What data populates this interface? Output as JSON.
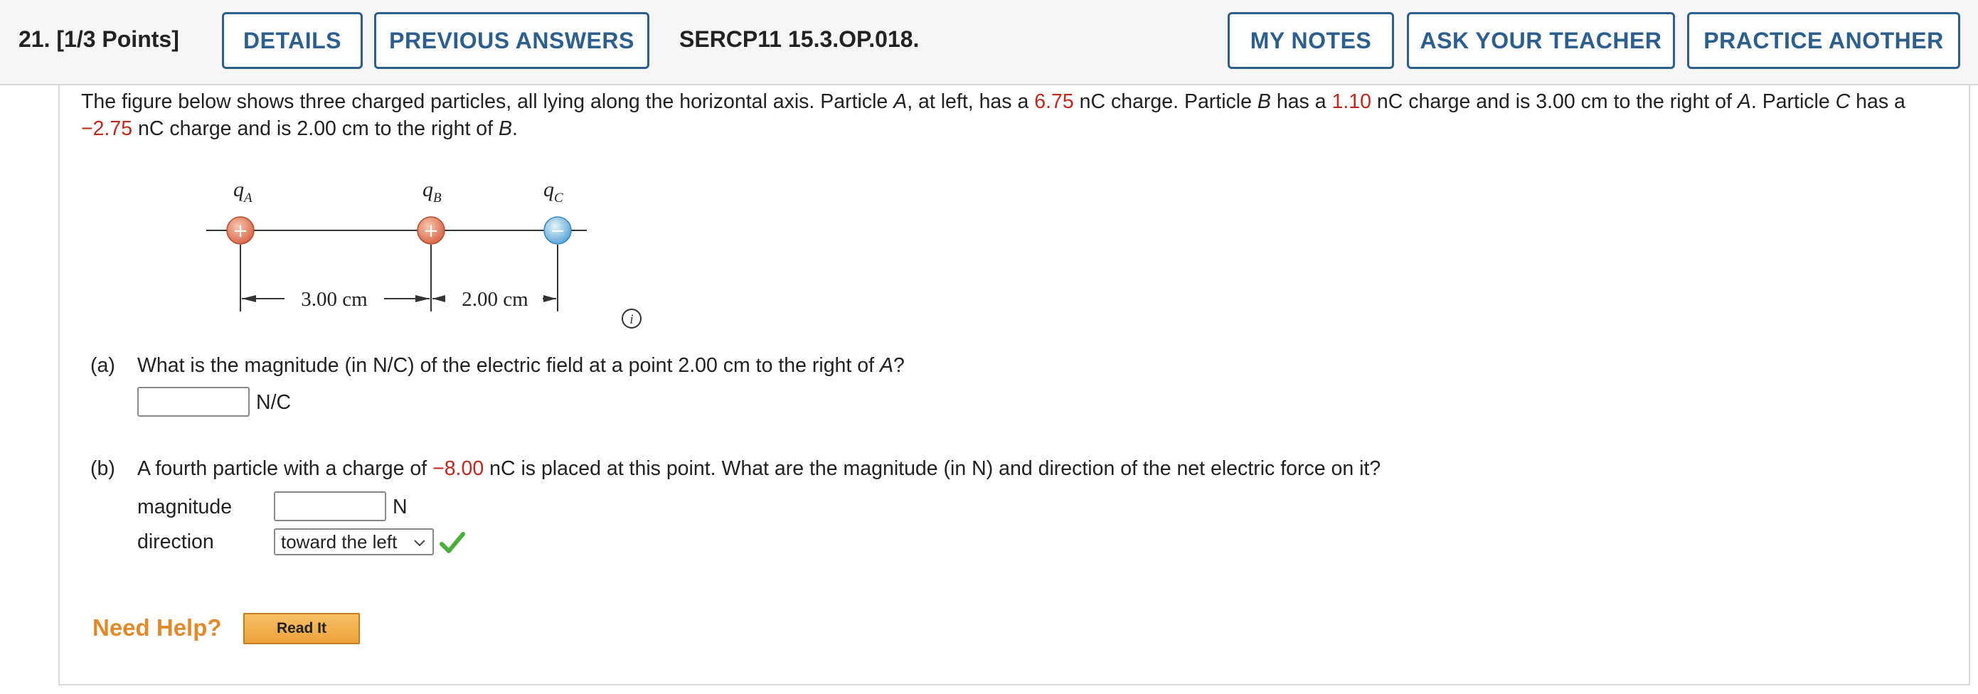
{
  "header": {
    "question_number": "21.",
    "points": "[1/3 Points]",
    "details_label": "DETAILS",
    "previous_answers_label": "PREVIOUS ANSWERS",
    "question_id": "SERCP11 15.3.OP.018.",
    "my_notes_label": "MY NOTES",
    "ask_teacher_label": "ASK YOUR TEACHER",
    "practice_another_label": "PRACTICE ANOTHER"
  },
  "stem": {
    "t1": "The figure below shows three charged particles, all lying along the horizontal axis. Particle ",
    "a": "A",
    "t2": ", at left, has a ",
    "qa": "6.75",
    "t3": " nC charge. Particle ",
    "b": "B",
    "t4": " has a ",
    "qb": "1.10",
    "t5": " nC charge and is 3.00 cm to the right of ",
    "a2": "A",
    "t6": ". Particle ",
    "c": "C",
    "t7": " has a ",
    "qc": "−2.75",
    "t8": " nC charge and is 2.00 cm to the right of ",
    "b2": "B",
    "t9": "."
  },
  "figure": {
    "label_a": "q",
    "sub_a": "A",
    "label_b": "q",
    "sub_b": "B",
    "label_c": "q",
    "sub_c": "C",
    "plus": "+",
    "minus": "−",
    "dist_ab": "3.00 cm",
    "dist_bc": "2.00 cm",
    "info": "i"
  },
  "part_a": {
    "label": "(a)",
    "q1": "What is the magnitude (in N/C) of the electric field at a point 2.00 cm to the right of ",
    "q_var": "A",
    "q2": "?",
    "answer": "",
    "unit": "N/C"
  },
  "part_b": {
    "label": "(b)",
    "q1": "A fourth particle with a charge of ",
    "charge": "−8.00",
    "q2": " nC is placed at this point. What are the magnitude (in N) and direction of the net electric force on it?",
    "magnitude_label": "magnitude",
    "magnitude_answer": "",
    "magnitude_unit": "N",
    "direction_label": "direction",
    "direction_value": "toward the left"
  },
  "help": {
    "need_help": "Need Help?",
    "read_it": "Read It"
  },
  "colors": {
    "accent": "#2d5f8e",
    "charge_highlight": "#c0281e",
    "help_orange": "#e08a2c",
    "check_green": "#4caf3c"
  }
}
